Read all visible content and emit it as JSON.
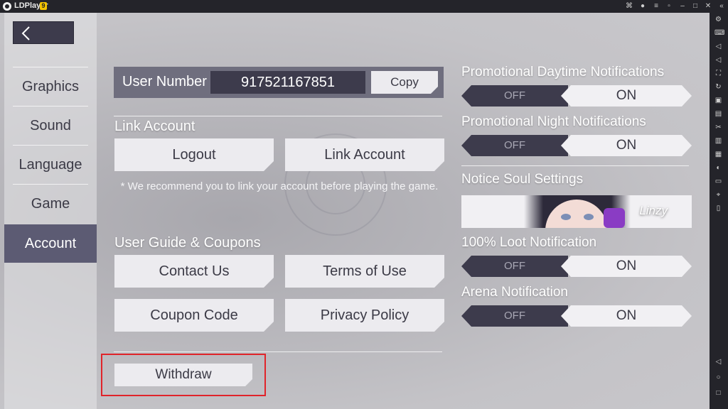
{
  "window": {
    "app_name": "LDPlayer",
    "badge": "9"
  },
  "sidebar": {
    "items": [
      {
        "label": "Graphics"
      },
      {
        "label": "Sound"
      },
      {
        "label": "Language"
      },
      {
        "label": "Game"
      },
      {
        "label": "Account"
      }
    ],
    "active": "Account"
  },
  "account": {
    "user_number_label": "User Number",
    "user_number_value": "917521167851",
    "copy_label": "Copy",
    "link_account_title": "Link Account",
    "logout_label": "Logout",
    "link_account_label": "Link Account",
    "link_note": "* We recommend you to link your account before playing the game.",
    "guide_title": "User Guide & Coupons",
    "contact_label": "Contact Us",
    "terms_label": "Terms of Use",
    "coupon_label": "Coupon Code",
    "privacy_label": "Privacy Policy",
    "withdraw_label": "Withdraw"
  },
  "notifications": {
    "off_label": "OFF",
    "on_label": "ON",
    "items": [
      {
        "title": "Promotional Daytime Notifications",
        "state": "ON"
      },
      {
        "title": "Promotional Night Notifications",
        "state": "ON"
      },
      {
        "title": "100% Loot Notification",
        "state": "ON"
      },
      {
        "title": "Arena Notification",
        "state": "ON"
      }
    ],
    "soul_title": "Notice Soul Settings",
    "soul_name": "Linzy"
  },
  "colors": {
    "accent_dark": "#3d3b4c",
    "active_tab": "#5c5b73",
    "button_light": "#ecebef",
    "highlight": "#e0242a"
  }
}
